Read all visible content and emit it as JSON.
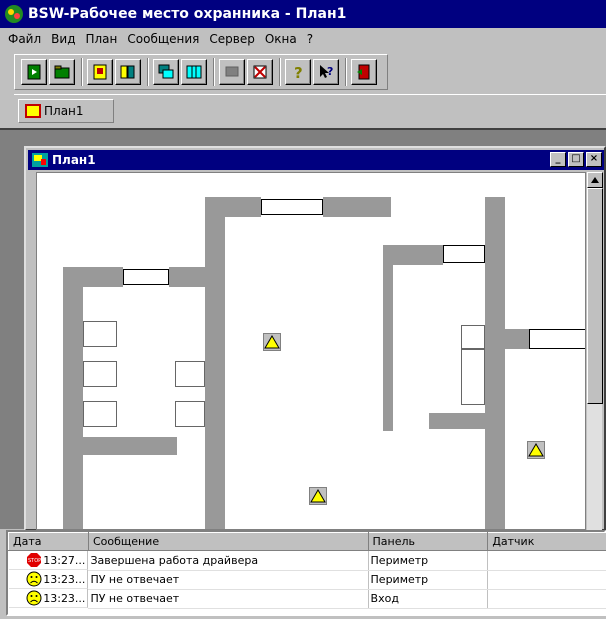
{
  "window": {
    "title": "BSW-Рабочее место охранника - План1"
  },
  "menu": [
    "Файл",
    "Вид",
    "План",
    "Сообщения",
    "Сервер",
    "Окна",
    "?"
  ],
  "toolbar": {
    "buttons": [
      {
        "icon": "new-document-icon"
      },
      {
        "icon": "open-folder-icon"
      },
      {
        "icon": "plan-properties-icon"
      },
      {
        "icon": "plan-books-icon"
      },
      {
        "icon": "cascade-windows-icon"
      },
      {
        "icon": "tile-windows-icon"
      },
      {
        "icon": "disabled-monitor-icon"
      },
      {
        "icon": "delete-object-icon"
      },
      {
        "icon": "help-icon"
      },
      {
        "icon": "context-help-icon"
      },
      {
        "icon": "exit-door-icon"
      }
    ]
  },
  "tabs": [
    {
      "label": "План1"
    }
  ],
  "child_window": {
    "title": "План1",
    "buttons": [
      "_",
      "□",
      "×"
    ]
  },
  "log": {
    "columns": [
      "Дата",
      "Сообщение",
      "Панель",
      "Датчик"
    ],
    "rows": [
      {
        "icon": "stop-icon",
        "time": "13:27...",
        "message": "Завершена работа драйвера",
        "panel": "Периметр",
        "sensor": ""
      },
      {
        "icon": "sad-face-icon",
        "time": "13:23...",
        "message": "ПУ не отвечает",
        "panel": "Периметр",
        "sensor": ""
      },
      {
        "icon": "sad-face-icon",
        "time": "13:23...",
        "message": "ПУ не отвечает",
        "panel": "Вход",
        "sensor": ""
      }
    ]
  },
  "colors": {
    "titlebar": "#000080",
    "face": "#c0c0c0",
    "wall": "#999999",
    "sensor": "#ffff00"
  }
}
